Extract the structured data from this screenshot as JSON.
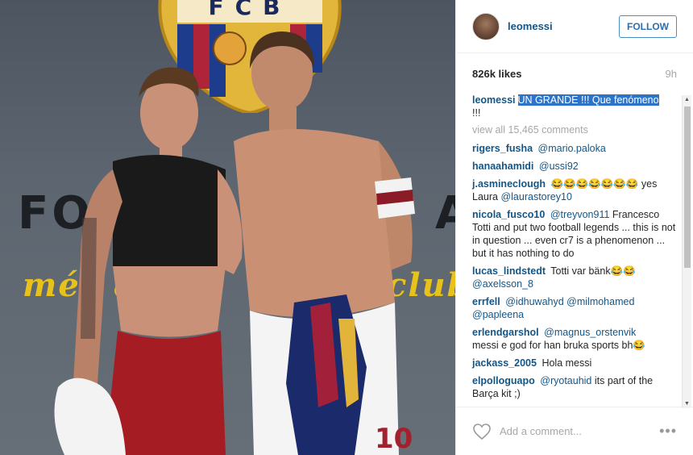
{
  "photo": {
    "crest_text": "FCB",
    "wall_text_left": "FO",
    "wall_text_right": "A",
    "wall_script_left": "més que",
    "wall_script_right": "club",
    "shirt_number": "10"
  },
  "header": {
    "username": "leomessi",
    "follow_label": "FOLLOW"
  },
  "meta": {
    "likes": "826k likes",
    "time": "9h"
  },
  "caption": {
    "user": "leomessi",
    "text_highlighted": "UN GRANDE !!! Que fenómeno",
    "text_rest": "!!!"
  },
  "view_all": "view all 15,465 comments",
  "comments": [
    {
      "user": "rigers_fusha",
      "mention": "@mario.paloka",
      "text": ""
    },
    {
      "user": "hanaahamidi",
      "mention": "@ussi92",
      "text": ""
    },
    {
      "user": "j.asmineclough",
      "mention": "",
      "text": "😂😂😂😂😂😂😂 yes Laura",
      "mention_after": "@laurastorey10"
    },
    {
      "user": "nicola_fusco10",
      "mention": "@treyvon911",
      "text": "Francesco Totti and put two football legends ... this is not in question ... even cr7 is a phenomenon ... but it has nothing to do"
    },
    {
      "user": "lucas_lindstedt",
      "mention": "",
      "text": "Totti var bänk😂😂",
      "mention_after": "@axelsson_8"
    },
    {
      "user": "errfell",
      "mention": "@idhuwahyd @milmohamed",
      "text": "",
      "mention_after": "@papleena"
    },
    {
      "user": "erlendgarshol",
      "mention": "@magnus_orstenvik",
      "text": "messi e god for han bruka sports bh😂"
    },
    {
      "user": "jackass_2005",
      "mention": "",
      "text": "Hola messi"
    },
    {
      "user": "elpolloguapo",
      "mention": "@ryotauhid",
      "text": "its part of the Barça kit ;)"
    }
  ],
  "add_comment": {
    "placeholder": "Add a comment...",
    "more_label": "•••"
  },
  "colors": {
    "link": "#125688",
    "highlight": "#2d74c9",
    "follow": "#3897f0"
  }
}
